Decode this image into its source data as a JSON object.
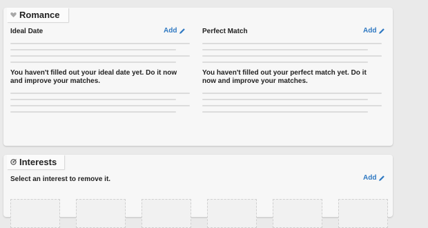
{
  "romance": {
    "title": "Romance",
    "icon": "heart-icon",
    "columns": [
      {
        "title": "Ideal Date",
        "add_label": "Add",
        "message": "You haven't filled out your ideal date yet. Do it now and improve your matches."
      },
      {
        "title": "Perfect Match",
        "add_label": "Add",
        "message": "You haven't filled out your perfect match yet. Do it now and improve your matches."
      }
    ]
  },
  "interests": {
    "title": "Interests",
    "icon": "target-icon",
    "hint": "Select an interest to remove it.",
    "add_label": "Add",
    "placeholder_tiles": 6
  },
  "colors": {
    "link": "#2f79c2",
    "panel": "#f7f7f7",
    "background": "#eaeaea"
  }
}
